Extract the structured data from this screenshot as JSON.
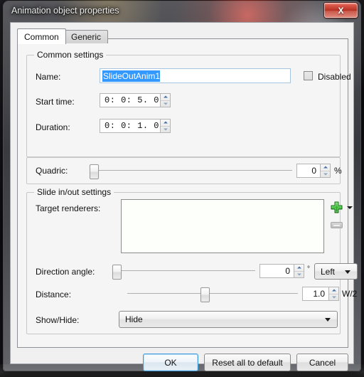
{
  "window": {
    "title": "Animation object properties",
    "close_label": "X",
    "close_icon": "close-icon"
  },
  "tabs": [
    {
      "label": "Common",
      "active": true
    },
    {
      "label": "Generic",
      "active": false
    }
  ],
  "common_settings": {
    "title": "Common settings",
    "name": {
      "label": "Name:",
      "value": "SlideOutAnim1",
      "selected": true
    },
    "disabled": {
      "label": "Disabled",
      "checked": false
    },
    "start_time": {
      "label": "Start time:",
      "value": "0:  0:  5.     0"
    },
    "duration": {
      "label": "Duration:",
      "value": "0:  0:  1.     0"
    },
    "quadric": {
      "label": "Quadric:",
      "value": "0",
      "suffix": "%",
      "slider_percent": 0
    }
  },
  "slide_settings": {
    "title": "Slide in/out settings",
    "target_renderers": {
      "label": "Target renderers:",
      "items": [],
      "add_icon": "plus-icon",
      "add_dropdown_icon": "chevron-down-icon",
      "remove_icon": "minus-icon"
    },
    "direction_angle": {
      "label": "Direction angle:",
      "value": "0",
      "suffix": "°",
      "slider_percent": 0,
      "preset": "Left"
    },
    "distance": {
      "label": "Distance:",
      "value": "1.0",
      "suffix": "W/2",
      "slider_percent": 45
    },
    "show_hide": {
      "label": "Show/Hide:",
      "value": "Hide"
    }
  },
  "footer": {
    "ok": "OK",
    "reset": "Reset all to default",
    "cancel": "Cancel"
  }
}
